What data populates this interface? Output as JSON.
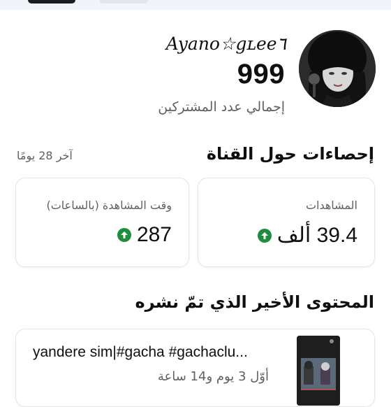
{
  "channel": {
    "name": "Ayano☆gʟee٦",
    "subscriber_count": "999",
    "subscriber_label": "إجمالي عدد المشتركين"
  },
  "stats": {
    "title": "إحصاءات حول القناة",
    "period": "آخر 28 يومًا",
    "views": {
      "label": "المشاهدات",
      "value": "39.4 ألف",
      "trend": "up-arrow-icon"
    },
    "watch_time": {
      "label": "وقت المشاهدة (بالساعات)",
      "value": "287",
      "trend": "up-arrow-icon"
    }
  },
  "recent": {
    "title": "المحتوى الأخير الذي تمّ نشره",
    "video": {
      "title": "yandere sim|#gacha #gachaclu...",
      "age": "أوّل 3 يوم و14 ساعة"
    }
  },
  "colors": {
    "trend_up": "#1e8e3e",
    "secondary_text": "#606060"
  }
}
